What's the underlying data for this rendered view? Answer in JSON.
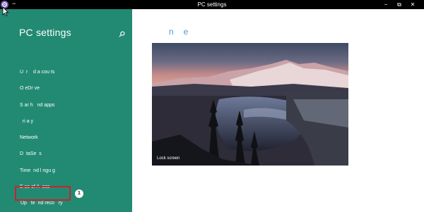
{
  "window": {
    "menu_glyph": "−",
    "title": "PC settings",
    "buttons": {
      "minimize": "−",
      "restore": "⧉",
      "close": "✕"
    }
  },
  "sidebar": {
    "title": "PC settings",
    "search_icon": "search-icon",
    "items": [
      {
        "label": "U  r    d a cou ts"
      },
      {
        "label": "O eDr ve"
      },
      {
        "label": "S ar h   nd apps"
      },
      {
        "label": "  ri a y"
      },
      {
        "label": "Network"
      },
      {
        "label": "D  taSe  s"
      },
      {
        "label": "Time  nd l ngu g"
      },
      {
        "label": "E se of A  ess"
      },
      {
        "label": "Up   te  nd reco   ry"
      }
    ],
    "callout_badge": "1"
  },
  "main": {
    "heading": "n   e",
    "lock_preview": {
      "label": "Lock screen"
    }
  },
  "colors": {
    "sidebar": "#228a72",
    "titlebar": "#000000",
    "heading_accent": "#4a9ad8",
    "callout_border": "#c8242c"
  }
}
